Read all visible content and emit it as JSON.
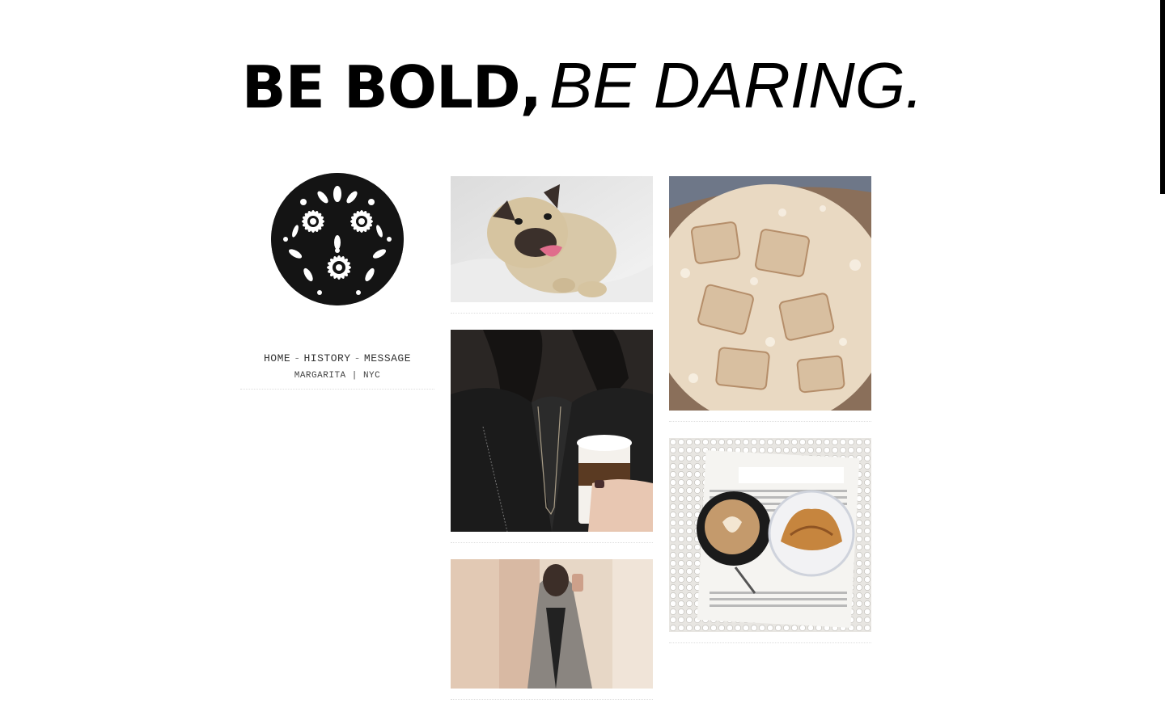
{
  "header": {
    "title_bold": "BE BOLD,",
    "title_italic": "BE DARING."
  },
  "sidebar": {
    "avatar_icon": "floral-medallion-icon",
    "nav": [
      {
        "label": "HOME"
      },
      {
        "label": "HISTORY"
      },
      {
        "label": "MESSAGE"
      }
    ],
    "nav_separator": "-",
    "subtitle": "MARGARITA | NYC"
  },
  "posts": {
    "column_1": [
      "pug-photo",
      "leather-jacket-coffee-photo",
      "fitting-room-selfie-photo"
    ],
    "column_2": [
      "iced-coffee-photo",
      "newspaper-latte-croissant-photo"
    ]
  },
  "colors": {
    "background": "#ffffff",
    "text": "#000000",
    "divider": "#dddddd"
  }
}
